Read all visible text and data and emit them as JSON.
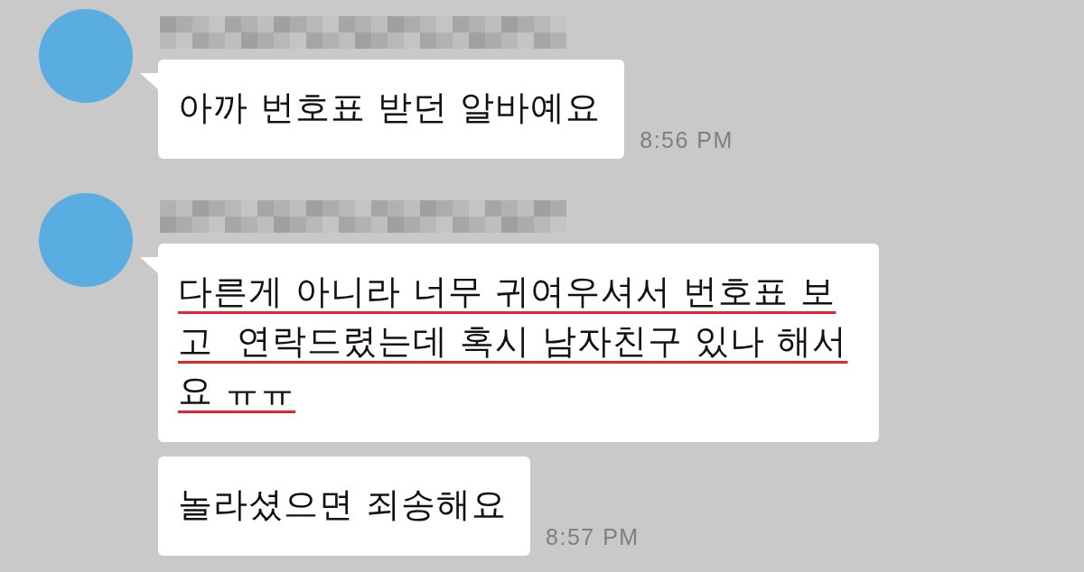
{
  "messages": [
    {
      "kind": "with_sender",
      "text": "아까 번호표 받던 알바예요",
      "underlined": false,
      "time": "8:56 PM"
    },
    {
      "kind": "with_sender",
      "text": "다른게 아니라 너무 귀여우셔서 번호표 보고  연락드렸는데 혹시 남자친구 있나 해서요 ㅠㅠ",
      "underlined": true
    },
    {
      "kind": "follow_up",
      "text": "놀라셨으면 죄송해요",
      "underlined": false,
      "time": "8:57 PM"
    }
  ]
}
